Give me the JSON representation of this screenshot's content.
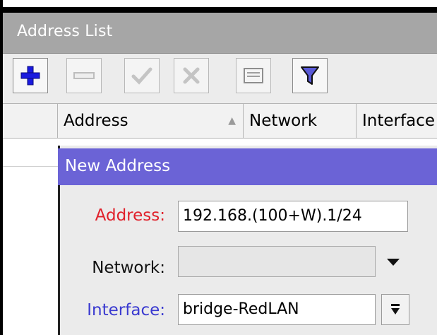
{
  "window": {
    "title": "Address List"
  },
  "toolbar": {
    "buttons": [
      {
        "icon": "add-icon",
        "label": "Add"
      },
      {
        "icon": "remove-icon",
        "label": "Remove"
      },
      {
        "icon": "enable-icon",
        "label": "Enable"
      },
      {
        "icon": "disable-icon",
        "label": "Disable"
      },
      {
        "icon": "comment-icon",
        "label": "Comment"
      },
      {
        "icon": "filter-icon",
        "label": "Filter"
      }
    ]
  },
  "table": {
    "columns": [
      "Address",
      "Network",
      "Interface"
    ],
    "sort_indicator": "▲"
  },
  "dialog": {
    "title": "New Address",
    "fields": {
      "address": {
        "label": "Address:",
        "value": "192.168.(100+W).1/24"
      },
      "network": {
        "label": "Network:",
        "value": ""
      },
      "interface": {
        "label": "Interface:",
        "value": "bridge-RedLAN"
      }
    }
  },
  "colors": {
    "titlebar_bg": "#a6a6a6",
    "dialog_title_bg": "#6b63d6",
    "address_label": "#e0202a",
    "interface_label": "#3a3ad0",
    "add_icon": "#1a1adf"
  }
}
